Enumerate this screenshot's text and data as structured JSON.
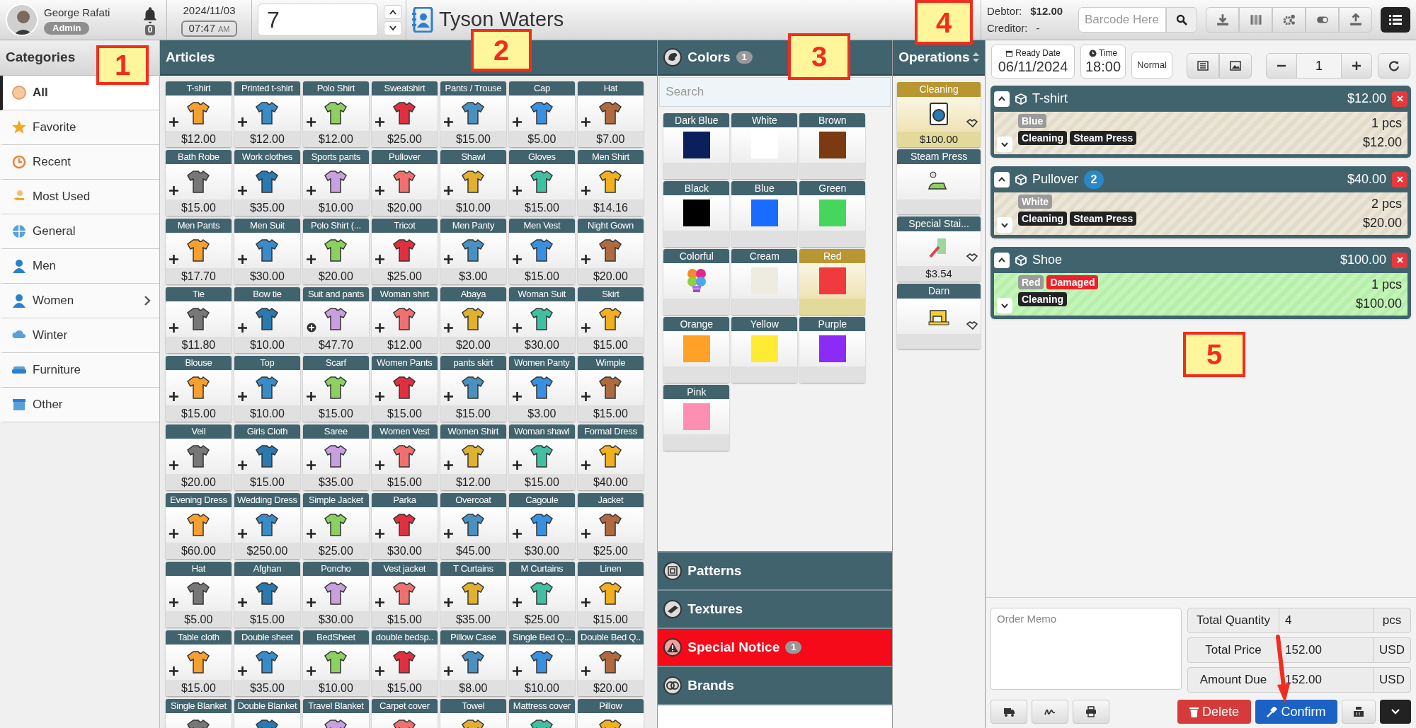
{
  "user": {
    "name": "George Rafati",
    "role": "Admin",
    "notifications": "0"
  },
  "date": "2024/11/03",
  "time": "07:47",
  "meridiem": "AM",
  "order_number": "7",
  "customer": "Tyson Waters",
  "balance": [
    {
      "label": "Debtor:",
      "value": "$12.00"
    },
    {
      "label": "Creditor:",
      "value": "-"
    }
  ],
  "barcode": {
    "placeholder": "Barcode Here"
  },
  "categories": {
    "title": "Categories",
    "items": [
      {
        "label": "All",
        "selected": true,
        "has_children": false
      },
      {
        "label": "Favorite",
        "selected": false,
        "has_children": false
      },
      {
        "label": "Recent",
        "selected": false,
        "has_children": false
      },
      {
        "label": "Most Used",
        "selected": false,
        "has_children": false
      },
      {
        "label": "General",
        "selected": false,
        "has_children": false
      },
      {
        "label": "Men",
        "selected": false,
        "has_children": false
      },
      {
        "label": "Women",
        "selected": false,
        "has_children": true
      },
      {
        "label": "Winter",
        "selected": false,
        "has_children": false
      },
      {
        "label": "Furniture",
        "selected": false,
        "has_children": false
      },
      {
        "label": "Other",
        "selected": false,
        "has_children": false
      }
    ]
  },
  "articles": {
    "title": "Articles",
    "items": [
      {
        "name": "T-shirt",
        "price": "$12.00",
        "bundle": false
      },
      {
        "name": "Printed t-shirt",
        "price": "$12.00",
        "bundle": false
      },
      {
        "name": "Polo Shirt",
        "price": "$12.00",
        "bundle": false
      },
      {
        "name": "Sweatshirt",
        "price": "$25.00",
        "bundle": false
      },
      {
        "name": "Pants / Trouse",
        "price": "$15.00",
        "bundle": false
      },
      {
        "name": "Cap",
        "price": "$5.00",
        "bundle": false
      },
      {
        "name": "Hat",
        "price": "$7.00",
        "bundle": false
      },
      {
        "name": "Bath Robe",
        "price": "$15.00",
        "bundle": false
      },
      {
        "name": "Work clothes",
        "price": "$35.00",
        "bundle": false
      },
      {
        "name": "Sports pants",
        "price": "$10.00",
        "bundle": false
      },
      {
        "name": "Pullover",
        "price": "$20.00",
        "bundle": false
      },
      {
        "name": "Shawl",
        "price": "$10.00",
        "bundle": false
      },
      {
        "name": "Gloves",
        "price": "$15.00",
        "bundle": false
      },
      {
        "name": "Men Shirt",
        "price": "$14.16",
        "bundle": false
      },
      {
        "name": "Men Pants",
        "price": "$17.70",
        "bundle": false
      },
      {
        "name": "Men Suit",
        "price": "$30.00",
        "bundle": false
      },
      {
        "name": "Polo Shirt (...",
        "price": "$20.00",
        "bundle": false
      },
      {
        "name": "Tricot",
        "price": "$25.00",
        "bundle": false
      },
      {
        "name": "Men Panty",
        "price": "$3.00",
        "bundle": false
      },
      {
        "name": "Men Vest",
        "price": "$15.00",
        "bundle": false
      },
      {
        "name": "Night Gown",
        "price": "$20.00",
        "bundle": false
      },
      {
        "name": "Tie",
        "price": "$11.80",
        "bundle": false
      },
      {
        "name": "Bow tie",
        "price": "$10.00",
        "bundle": false
      },
      {
        "name": "Suit and pants",
        "price": "$47.70",
        "bundle": true
      },
      {
        "name": "Woman shirt",
        "price": "$12.00",
        "bundle": false
      },
      {
        "name": "Abaya",
        "price": "$20.00",
        "bundle": false
      },
      {
        "name": "Woman Suit",
        "price": "$30.00",
        "bundle": false
      },
      {
        "name": "Skirt",
        "price": "$15.00",
        "bundle": false
      },
      {
        "name": "Blouse",
        "price": "$15.00",
        "bundle": false
      },
      {
        "name": "Top",
        "price": "$10.00",
        "bundle": false
      },
      {
        "name": "Scarf",
        "price": "$15.00",
        "bundle": false
      },
      {
        "name": "Women Pants",
        "price": "$15.00",
        "bundle": false
      },
      {
        "name": "pants skirt",
        "price": "$15.00",
        "bundle": false
      },
      {
        "name": "Women Panty",
        "price": "$3.00",
        "bundle": false
      },
      {
        "name": "Wimple",
        "price": "$15.00",
        "bundle": false
      },
      {
        "name": "Veil",
        "price": "$20.00",
        "bundle": false
      },
      {
        "name": "Girls Cloth",
        "price": "$15.00",
        "bundle": false
      },
      {
        "name": "Saree",
        "price": "$35.00",
        "bundle": false
      },
      {
        "name": "Women Vest",
        "price": "$15.00",
        "bundle": false
      },
      {
        "name": "Women Shirt",
        "price": "$12.00",
        "bundle": false
      },
      {
        "name": "Woman shawl",
        "price": "$15.00",
        "bundle": false
      },
      {
        "name": "Formal Dress",
        "price": "$40.00",
        "bundle": false
      },
      {
        "name": "Evening Dress",
        "price": "$60.00",
        "bundle": false
      },
      {
        "name": "Wedding Dress",
        "price": "$250.00",
        "bundle": false
      },
      {
        "name": "Simple Jacket",
        "price": "$25.00",
        "bundle": false
      },
      {
        "name": "Parka",
        "price": "$30.00",
        "bundle": false
      },
      {
        "name": "Overcoat",
        "price": "$45.00",
        "bundle": false
      },
      {
        "name": "Cagoule",
        "price": "$30.00",
        "bundle": false
      },
      {
        "name": "Jacket",
        "price": "$25.00",
        "bundle": false
      },
      {
        "name": "Hat",
        "price": "$5.00",
        "bundle": false
      },
      {
        "name": "Afghan",
        "price": "$15.00",
        "bundle": false
      },
      {
        "name": "Poncho",
        "price": "$30.00",
        "bundle": false
      },
      {
        "name": "Vest jacket",
        "price": "$15.00",
        "bundle": false
      },
      {
        "name": "T Curtains",
        "price": "$35.00",
        "bundle": false
      },
      {
        "name": "M Curtains",
        "price": "$25.00",
        "bundle": false
      },
      {
        "name": "Linen",
        "price": "$15.00",
        "bundle": false
      },
      {
        "name": "Table cloth",
        "price": "$15.00",
        "bundle": false
      },
      {
        "name": "Double sheet",
        "price": "$35.00",
        "bundle": false
      },
      {
        "name": "BedSheet",
        "price": "$10.00",
        "bundle": false
      },
      {
        "name": "double bedsp..",
        "price": "$15.00",
        "bundle": false
      },
      {
        "name": "Pillow Case",
        "price": "$8.00",
        "bundle": false
      },
      {
        "name": "Single Bed Q...",
        "price": "$10.00",
        "bundle": false
      },
      {
        "name": "Double Bed Q..",
        "price": "$20.00",
        "bundle": false
      },
      {
        "name": "Single Blanket"
      },
      {
        "name": "Double Blanket"
      },
      {
        "name": "Travel Blanket"
      },
      {
        "name": "Carpet cover"
      },
      {
        "name": "Towel"
      },
      {
        "name": "Mattress cover"
      },
      {
        "name": "Pillow"
      }
    ]
  },
  "colors": {
    "title": "Colors",
    "count": "1",
    "search": {
      "placeholder": "Search"
    },
    "items": [
      {
        "name": "Dark Blue",
        "kind": "swatch",
        "color": "#0a1f5c",
        "selected": false
      },
      {
        "name": "White",
        "kind": "swatch",
        "color": "#ffffff",
        "selected": false
      },
      {
        "name": "Brown",
        "kind": "swatch",
        "color": "#7b3a12",
        "selected": false
      },
      {
        "name": "Black",
        "kind": "swatch",
        "color": "#000000",
        "selected": false
      },
      {
        "name": "Blue",
        "kind": "swatch",
        "color": "#1a6cff",
        "selected": false
      },
      {
        "name": "Green",
        "kind": "swatch",
        "color": "#46d65e",
        "selected": false
      },
      {
        "name": "Colorful",
        "kind": "multicolor",
        "selected": false
      },
      {
        "name": "Cream",
        "kind": "swatch",
        "color": "#eeebe0",
        "selected": false
      },
      {
        "name": "Red",
        "kind": "swatch",
        "color": "#f03a3e",
        "selected": true
      },
      {
        "name": "Orange",
        "kind": "swatch",
        "color": "#ffa126",
        "selected": false
      },
      {
        "name": "Yellow",
        "kind": "swatch",
        "color": "#ffeb33",
        "selected": false
      },
      {
        "name": "Purple",
        "kind": "swatch",
        "color": "#8c2bf5",
        "selected": false
      },
      {
        "name": "Pink",
        "kind": "swatch",
        "color": "#ff8fb2",
        "selected": false
      }
    ]
  },
  "sections": [
    {
      "title": "Patterns",
      "alert": false
    },
    {
      "title": "Textures",
      "alert": false
    },
    {
      "title": "Special Notice",
      "count": "1",
      "alert": true
    },
    {
      "title": "Brands",
      "alert": false
    }
  ],
  "operations": {
    "title": "Operations",
    "items": [
      {
        "name": "Cleaning",
        "price": "$100.00",
        "selected": true,
        "shared": true
      },
      {
        "name": "Steam Press",
        "selected": false,
        "shared": false
      },
      {
        "name": "Special Stai...",
        "price": "$3.54",
        "selected": false,
        "shared": true
      },
      {
        "name": "Darn",
        "selected": false,
        "shared": true
      }
    ]
  },
  "order_toolbar": {
    "ready_date": {
      "label": "Ready Date",
      "value": "06/11/2024"
    },
    "time": {
      "label": "Time",
      "value": "18:00"
    },
    "priority": "Normal",
    "quantity": "1"
  },
  "order_items": [
    {
      "name": "T-shirt",
      "total": "$12.00",
      "quantity": "1 pcs",
      "unit_price": "$12.00",
      "selected": false,
      "tags": [
        {
          "label": "Blue",
          "kind": "color"
        }
      ],
      "operations": [
        "Cleaning",
        "Steam Press"
      ]
    },
    {
      "name": "Pullover",
      "count": "2",
      "total": "$40.00",
      "quantity": "2 pcs",
      "unit_price": "$20.00",
      "selected": false,
      "tags": [
        {
          "label": "White",
          "kind": "color"
        }
      ],
      "operations": [
        "Cleaning",
        "Steam Press"
      ]
    },
    {
      "name": "Shoe",
      "total": "$100.00",
      "quantity": "1 pcs",
      "unit_price": "$100.00",
      "selected": true,
      "tags": [
        {
          "label": "Red",
          "kind": "color"
        },
        {
          "label": "Damaged",
          "kind": "notice"
        }
      ],
      "operations": [
        "Cleaning"
      ]
    }
  ],
  "memo": {
    "placeholder": "Order Memo"
  },
  "totals": [
    {
      "label": "Total Quantity",
      "value": "4",
      "unit": "pcs"
    },
    {
      "label": "Total Price",
      "value": "152.00",
      "unit": "USD"
    },
    {
      "label": "Amount Due",
      "value": "152.00",
      "unit": "USD"
    }
  ],
  "actions": {
    "delete": "Delete",
    "confirm": "Confirm"
  },
  "annotations": [
    "1",
    "2",
    "3",
    "4",
    "5"
  ]
}
